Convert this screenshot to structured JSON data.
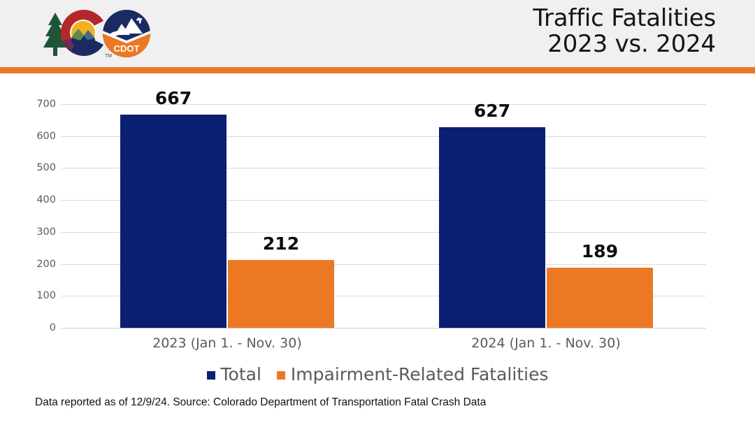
{
  "header": {
    "title_line1": "Traffic Fatalities",
    "title_line2": "2023 vs. 2024",
    "logo_state_name": "colorado-state-logo",
    "logo_cdot_name": "cdot-logo",
    "logo_cdot_text": "CDOT",
    "logo_trademark": "TM",
    "accent_color": "#ec7823",
    "background_color": "#f0f0f0"
  },
  "footer": {
    "note": "Data reported as of 12/9/24. Source: Colorado Department of Transportation Fatal Crash Data"
  },
  "chart_data": {
    "type": "bar",
    "title": "Traffic Fatalities 2023 vs. 2024",
    "xlabel": "",
    "ylabel": "",
    "ylim": [
      0,
      700
    ],
    "yticks": [
      0,
      100,
      200,
      300,
      400,
      500,
      600,
      700
    ],
    "ytick_labels": [
      "0",
      "100",
      "200",
      "300",
      "400",
      "500",
      "600",
      "700"
    ],
    "grid": true,
    "legend_position": "bottom",
    "categories": [
      "2023 (Jan 1. - Nov. 30)",
      "2024 (Jan 1. - Nov. 30)"
    ],
    "series": [
      {
        "name": "Total",
        "color": "#0b1f72",
        "values": [
          667,
          627
        ],
        "value_labels": [
          "667",
          "627"
        ]
      },
      {
        "name": "Impairment-Related Fatalities",
        "color": "#ec7823",
        "values": [
          212,
          189
        ],
        "value_labels": [
          "212",
          "189"
        ]
      }
    ]
  }
}
